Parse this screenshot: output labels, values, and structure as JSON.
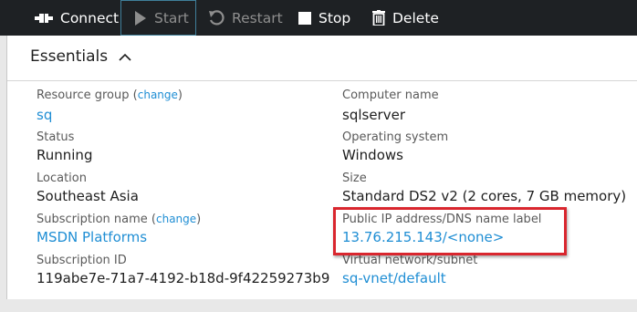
{
  "toolbar": {
    "connect_label": "Connect",
    "start_label": "Start",
    "restart_label": "Restart",
    "stop_label": "Stop",
    "delete_label": "Delete"
  },
  "essentials": {
    "title": "Essentials",
    "left": [
      {
        "label": "Resource group",
        "link": "change",
        "value": "sq",
        "value_is_link": true
      },
      {
        "label": "Status",
        "value": "Running",
        "value_is_link": false
      },
      {
        "label": "Location",
        "value": "Southeast Asia",
        "value_is_link": false
      },
      {
        "label": "Subscription name",
        "link": "change",
        "value": "MSDN Platforms",
        "value_is_link": true
      },
      {
        "label": "Subscription ID",
        "value": "119abe7e-71a7-4192-b18d-9f42259273b9",
        "value_is_link": false
      }
    ],
    "right": [
      {
        "label": "Computer name",
        "value": "sqlserver",
        "value_is_link": false
      },
      {
        "label": "Operating system",
        "value": "Windows",
        "value_is_link": false
      },
      {
        "label": "Size",
        "value": "Standard DS2 v2 (2 cores, 7 GB memory)",
        "value_is_link": false
      },
      {
        "label": "Public IP address/DNS name label",
        "value": "13.76.215.143/<none>",
        "value_is_link": true
      },
      {
        "label": "Virtual network/subnet",
        "value": "sq-vnet/default",
        "value_is_link": true
      }
    ]
  },
  "colors": {
    "toolbar_bg": "#1e2124",
    "link": "#1f8ed4",
    "highlight": "#d9262e"
  },
  "icons": [
    "connect-icon",
    "play-icon",
    "restart-icon",
    "stop-icon",
    "trash-icon",
    "chevron-up-icon"
  ]
}
